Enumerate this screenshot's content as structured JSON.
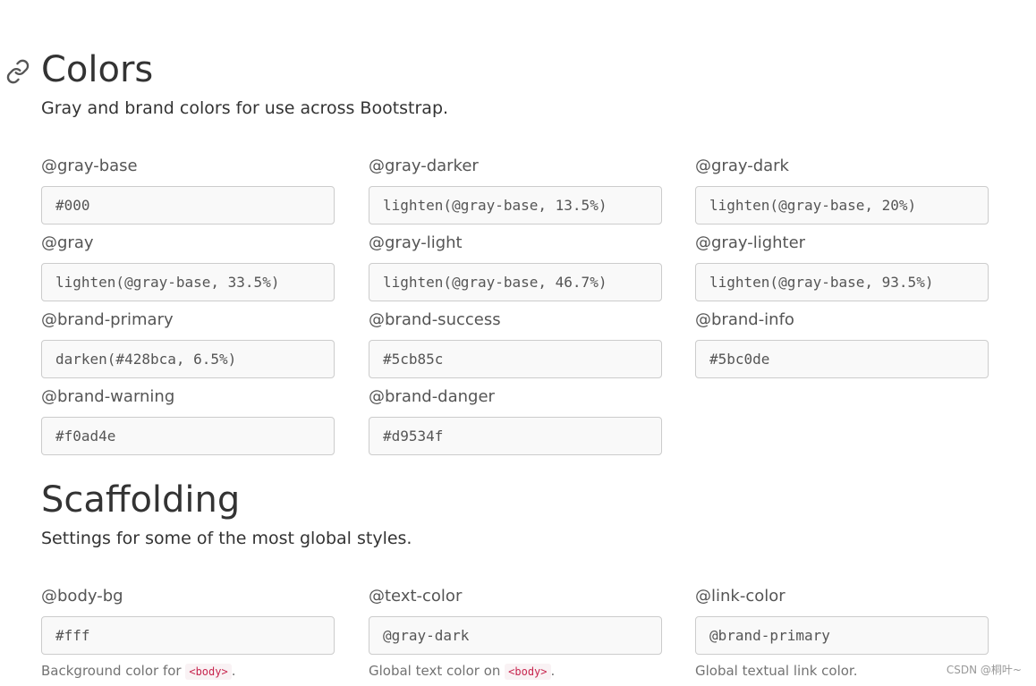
{
  "colors_section": {
    "title": "Colors",
    "description": "Gray and brand colors for use across Bootstrap.",
    "fields": [
      {
        "label": "@gray-base",
        "value": "#000"
      },
      {
        "label": "@gray-darker",
        "value": "lighten(@gray-base, 13.5%)"
      },
      {
        "label": "@gray-dark",
        "value": "lighten(@gray-base, 20%)"
      },
      {
        "label": "@gray",
        "value": "lighten(@gray-base, 33.5%)"
      },
      {
        "label": "@gray-light",
        "value": "lighten(@gray-base, 46.7%)"
      },
      {
        "label": "@gray-lighter",
        "value": "lighten(@gray-base, 93.5%)"
      },
      {
        "label": "@brand-primary",
        "value": "darken(#428bca, 6.5%)"
      },
      {
        "label": "@brand-success",
        "value": "#5cb85c"
      },
      {
        "label": "@brand-info",
        "value": "#5bc0de"
      },
      {
        "label": "@brand-warning",
        "value": "#f0ad4e"
      },
      {
        "label": "@brand-danger",
        "value": "#d9534f"
      }
    ]
  },
  "scaffolding_section": {
    "title": "Scaffolding",
    "description": "Settings for some of the most global styles.",
    "fields": [
      {
        "label": "@body-bg",
        "value": "#fff",
        "help_prefix": "Background color for ",
        "help_code": "<body>",
        "help_suffix": "."
      },
      {
        "label": "@text-color",
        "value": "@gray-dark",
        "help_prefix": "Global text color on ",
        "help_code": "<body>",
        "help_suffix": "."
      },
      {
        "label": "@link-color",
        "value": "@brand-primary",
        "help_prefix": "Global textual link color.",
        "help_code": "",
        "help_suffix": ""
      }
    ]
  },
  "watermark": "CSDN @桐叶~",
  "colors": {
    "text": "#333333",
    "label": "#555555",
    "input_bg": "#f9f9f9",
    "input_border": "#cccccc",
    "help": "#737373",
    "code_text": "#c7254e",
    "code_bg": "#f9f2f4"
  },
  "icons": {
    "anchor": "link-icon"
  }
}
